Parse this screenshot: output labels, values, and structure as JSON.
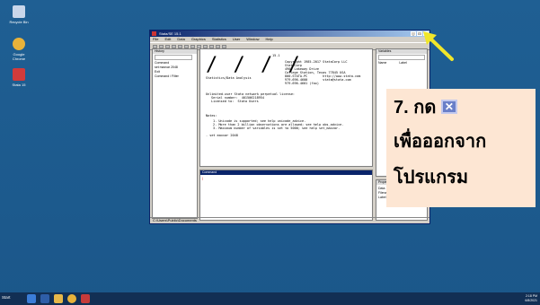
{
  "desktop": {
    "icons": [
      {
        "label": "Recycle Bin",
        "icon": "recycle-bin-icon",
        "color": "#c9d6ea"
      },
      {
        "label": "Google Chrome",
        "icon": "chrome-icon",
        "color": "#e8b23a"
      },
      {
        "label": "Stata 15",
        "icon": "stata-icon",
        "color": "#d23b3b"
      }
    ]
  },
  "window": {
    "title": "Stata/SE 15.1",
    "menu": [
      "File",
      "Edit",
      "Data",
      "Graphics",
      "Statistics",
      "User",
      "Window",
      "Help"
    ],
    "history": {
      "header": "History",
      "search_placeholder": "Filter commands here",
      "items": [
        "Command",
        "set maxvar 2048",
        "Exit",
        "Command / Filter"
      ]
    },
    "variables": {
      "header": "Variables",
      "search_placeholder": "Filter variables here",
      "columns": [
        "Name",
        "Label"
      ]
    },
    "properties": {
      "header": "Properties",
      "rows": [
        "Data",
        "Filename",
        "Label"
      ]
    },
    "results": {
      "logo": "/ / / /",
      "version": "15.1",
      "lines": [
        "Copyright 1985-2017 StataCorp LLC",
        "StataCorp",
        "4905 Lakeway Drive",
        "College Station, Texas 77845 USA",
        "800-STATA-PC        http://www.stata.com",
        "979-696-4600        stata@stata.com",
        "979-696-4601 (fax)"
      ],
      "edition": "Statistics/Data Analysis",
      "user_lines": [
        "Unlimited-user Stata network perpetual license:",
        "Serial number:  401506218954",
        "Licensed to:  Stata Users"
      ],
      "notes_header": "Notes:",
      "notes": [
        "1. Unicode is supported; see help unicode_advice.",
        "2. More than 2 billion observations are allowed; see help obs_advice.",
        "3. Maximum number of variables is set to 5000; see help set_maxvar."
      ],
      "prompt_line": ". set maxvar 2048",
      "link_text": "help unicode_advice"
    },
    "command": {
      "header": "Command"
    },
    "status": "C:\\Users\\Public\\Documents"
  },
  "callout": {
    "line1": "7. กด",
    "line2": "เพื่อออกจาก",
    "line3": "โปรแกรม",
    "close_glyph": "✕",
    "background": "#fde6d3",
    "icon_color": "#6a7fc8"
  },
  "arrow": {
    "color": "#f0e62a"
  },
  "taskbar": {
    "start": "Start",
    "apps": [
      {
        "icon": "server-manager-icon",
        "color": "#3b7dd8"
      },
      {
        "icon": "powershell-icon",
        "color": "#2e5ea8"
      },
      {
        "icon": "file-explorer-icon",
        "color": "#e6b84a"
      },
      {
        "icon": "chrome-icon",
        "color": "#e8b23a"
      },
      {
        "icon": "stata-icon",
        "color": "#c63a3a"
      }
    ],
    "clock": "2:18 PM",
    "date": "6/8/2021"
  }
}
